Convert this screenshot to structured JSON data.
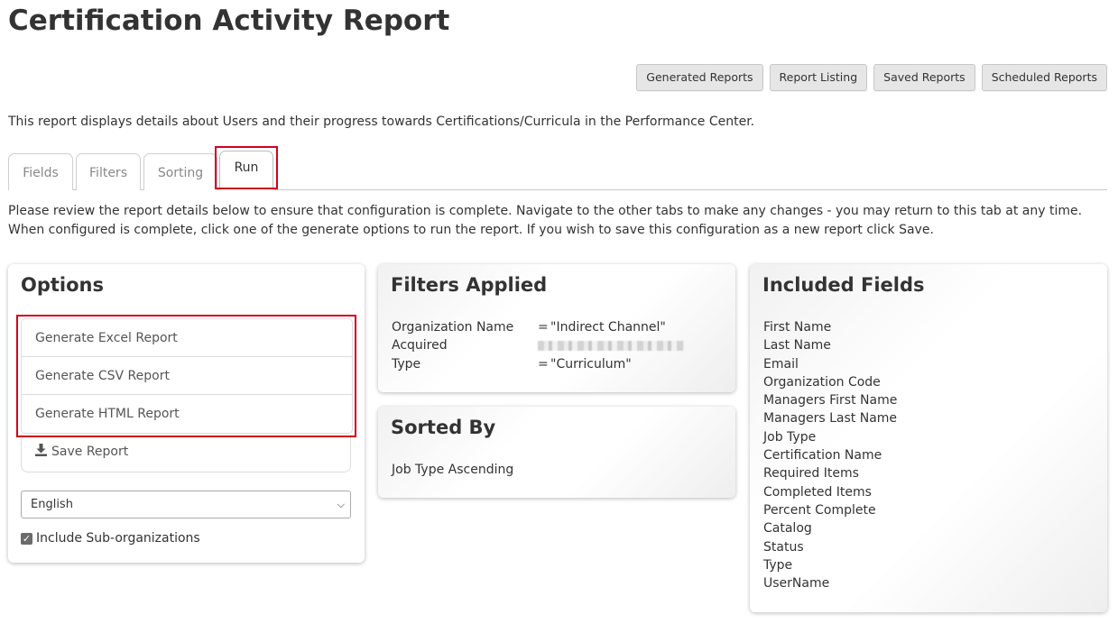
{
  "page": {
    "title": "Certification Activity Report",
    "description": "This report displays details about Users and their progress towards Certifications/Curricula in the Performance Center.",
    "instructions": "Please review the report details below to ensure that configuration is complete. Navigate to the other tabs to make any changes - you may return to this tab at any time. When configured is complete, click one of the generate options to run the report. If you wish to save this configuration as a new report click Save."
  },
  "top_buttons": {
    "generated_reports": "Generated Reports",
    "report_listing": "Report Listing",
    "saved_reports": "Saved Reports",
    "scheduled_reports": "Scheduled Reports"
  },
  "tabs": {
    "fields": "Fields",
    "filters": "Filters",
    "sorting": "Sorting",
    "run": "Run",
    "active": "Run"
  },
  "options": {
    "title": "Options",
    "generate_excel": "Generate Excel Report",
    "generate_csv": "Generate CSV Report",
    "generate_html": "Generate HTML Report",
    "save_report": "Save Report",
    "language_selected": "English",
    "include_suborgs_label": "Include Sub-organizations",
    "include_suborgs_checked": true
  },
  "filters_applied": {
    "title": "Filters Applied",
    "rows": [
      {
        "name": "Organization Name",
        "op": "=",
        "value": "\"Indirect Channel\""
      },
      {
        "name": "Acquired",
        "op": "",
        "value": ""
      },
      {
        "name": "Type",
        "op": "=",
        "value": "\"Curriculum\""
      }
    ]
  },
  "sorted_by": {
    "title": "Sorted By",
    "text": "Job Type Ascending"
  },
  "included_fields": {
    "title": "Included Fields",
    "items": [
      "First Name",
      "Last Name",
      "Email",
      "Organization Code",
      "Managers First Name",
      "Managers Last Name",
      "Job Type",
      "Certification Name",
      "Required Items",
      "Completed Items",
      "Percent Complete",
      "Catalog",
      "Status",
      "Type",
      "UserName"
    ]
  },
  "colors": {
    "highlight_red": "#d0021b",
    "text": "#333333",
    "button_bg": "#e6e6e6"
  }
}
